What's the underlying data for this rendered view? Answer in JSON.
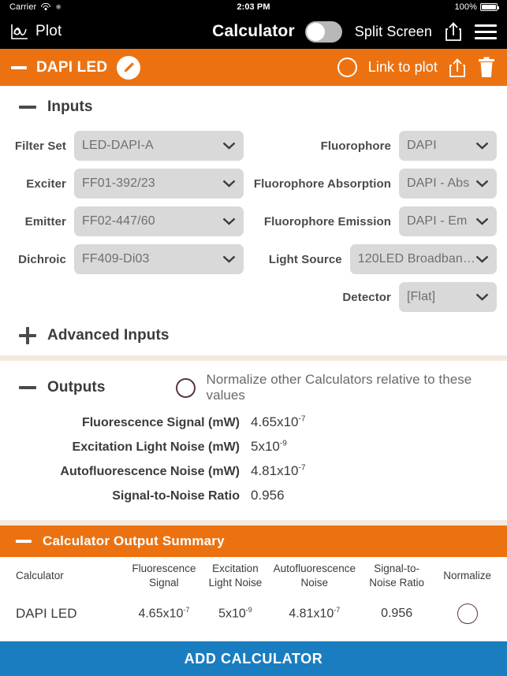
{
  "status_bar": {
    "carrier": "Carrier",
    "wifi_icon": "wifi-icon",
    "sync_icon": "sync-icon",
    "time": "2:03 PM",
    "battery_percent": "100%",
    "battery_icon": "battery-full-icon"
  },
  "nav": {
    "plot_label": "Plot",
    "plot_icon": "plot-graph-icon",
    "title": "Calculator",
    "split_screen_label": "Split Screen",
    "split_screen_on": false,
    "share_icon": "share-upload-icon",
    "menu_icon": "hamburger-menu-icon"
  },
  "calculator_bar": {
    "collapse_icon": "minus-icon",
    "name": "DAPI LED",
    "edit_icon": "pencil-edit-icon",
    "link_to_plot_label": "Link to plot",
    "link_to_plot_checked": false,
    "share_icon": "share-upload-icon",
    "delete_icon": "trash-icon",
    "accent_color": "#ec7211"
  },
  "inputs": {
    "collapse_icon": "minus-icon",
    "title": "Inputs",
    "rows": [
      {
        "left": {
          "label": "Filter Set",
          "value": "LED-DAPI-A"
        },
        "right": {
          "label": "Fluorophore",
          "value": "DAPI"
        }
      },
      {
        "left": {
          "label": "Exciter",
          "value": "FF01-392/23"
        },
        "right": {
          "label": "Fluorophore Absorption",
          "value": "DAPI - Abs"
        }
      },
      {
        "left": {
          "label": "Emitter",
          "value": "FF02-447/60"
        },
        "right": {
          "label": "Fluorophore Emission",
          "value": "DAPI - Em"
        }
      },
      {
        "left": {
          "label": "Dichroic",
          "value": "FF409-Di03"
        },
        "right": {
          "label": "Light Source",
          "value": "120LED Broadban…"
        }
      },
      {
        "left": {
          "label": "",
          "value": ""
        },
        "right": {
          "label": "Detector",
          "value": "[Flat]"
        }
      }
    ],
    "advanced_icon": "plus-icon",
    "advanced_label": "Advanced Inputs"
  },
  "outputs": {
    "collapse_icon": "minus-icon",
    "title": "Outputs",
    "normalize_label": "Normalize other Calculators relative to these values",
    "normalize_checked": false,
    "rows": [
      {
        "label": "Fluorescence Signal (mW)",
        "mantissa": "4.65x10",
        "exponent": "-7"
      },
      {
        "label": "Excitation Light Noise (mW)",
        "mantissa": "5x10",
        "exponent": "-9"
      },
      {
        "label": "Autofluorescence Noise (mW)",
        "mantissa": "4.81x10",
        "exponent": "-7"
      },
      {
        "label": "Signal-to-Noise Ratio",
        "mantissa": "0.956",
        "exponent": ""
      }
    ]
  },
  "summary": {
    "collapse_icon": "minus-icon",
    "title": "Calculator Output Summary",
    "headers": [
      "Calculator",
      "Fluorescence\nSignal",
      "Excitation\nLight Noise",
      "Autofluorescence\nNoise",
      "Signal-to-\nNoise Ratio",
      "Normalize"
    ],
    "row": {
      "calculator": "DAPI LED",
      "fluorescence_signal": {
        "mantissa": "4.65x10",
        "exponent": "-7"
      },
      "excitation_light_noise": {
        "mantissa": "5x10",
        "exponent": "-9"
      },
      "autofluorescence_noise": {
        "mantissa": "4.81x10",
        "exponent": "-7"
      },
      "signal_to_noise_ratio": "0.956",
      "normalize_checked": false,
      "normalize_icon": "radio-circle-icon"
    }
  },
  "footer": {
    "add_calculator_label": "ADD CALCULATOR",
    "color": "#1a7dc0"
  }
}
